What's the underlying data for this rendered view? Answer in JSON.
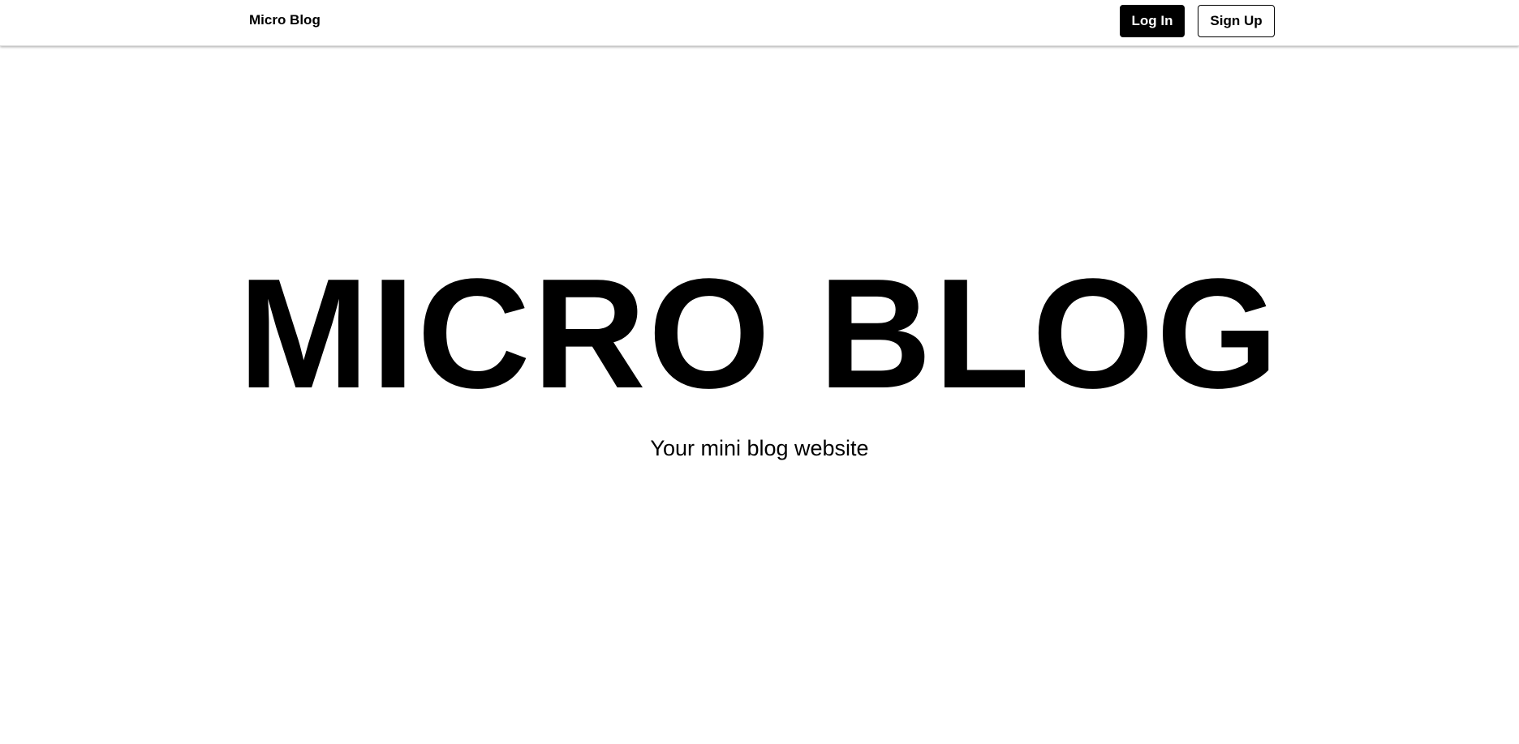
{
  "navbar": {
    "brand": "Micro Blog",
    "login_label": "Log In",
    "signup_label": "Sign Up"
  },
  "hero": {
    "title": "MICRO BLOG",
    "subtitle": "Your mini blog website"
  },
  "colors": {
    "background": "#ffffff",
    "text": "#000000",
    "primary_button_bg": "#000000",
    "primary_button_text": "#ffffff"
  }
}
